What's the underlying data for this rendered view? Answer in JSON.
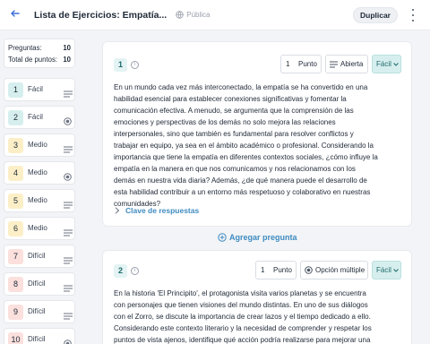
{
  "header": {
    "back_icon": "arrow-left-icon",
    "title": "Lista de Ejercicios: Empatía...",
    "visibility": "Pública",
    "duplicate_label": "Duplicar",
    "menu_icon": "more-vertical-icon"
  },
  "summary": {
    "questions_label": "Preguntas:",
    "questions_value": "10",
    "points_label": "Total de puntos:",
    "points_value": "10"
  },
  "questions": [
    {
      "num": "1",
      "difficulty": "Fácil",
      "type_icon": "lines-icon",
      "color": "#d6efee"
    },
    {
      "num": "2",
      "difficulty": "Fácil",
      "type_icon": "radio-icon",
      "color": "#d6efee"
    },
    {
      "num": "3",
      "difficulty": "Medio",
      "type_icon": "lines-icon",
      "color": "#fcefc7"
    },
    {
      "num": "4",
      "difficulty": "Medio",
      "type_icon": "radio-icon",
      "color": "#fcefc7"
    },
    {
      "num": "5",
      "difficulty": "Medio",
      "type_icon": "lines-icon",
      "color": "#fcefc7"
    },
    {
      "num": "6",
      "difficulty": "Medio",
      "type_icon": "lines-icon",
      "color": "#fcefc7"
    },
    {
      "num": "7",
      "difficulty": "Difícil",
      "type_icon": "lines-icon",
      "color": "#fbe0dd"
    },
    {
      "num": "8",
      "difficulty": "Difícil",
      "type_icon": "lines-icon",
      "color": "#fbe0dd"
    },
    {
      "num": "9",
      "difficulty": "Difícil",
      "type_icon": "lines-icon",
      "color": "#fbe0dd"
    },
    {
      "num": "10",
      "difficulty": "Difícil",
      "type_icon": "radio-icon",
      "color": "#fbe0dd"
    }
  ],
  "card1": {
    "number": "1",
    "points_value": "1",
    "points_label": "Punto",
    "type_label": "Abierta",
    "difficulty": "Fácil",
    "text": "En un mundo cada vez más interconectado, la empatía se ha convertido en una habilidad esencial para establecer conexiones significativas y fomentar la comunicación efectiva. A menudo, se argumenta que la comprensión de las emociones y perspectivas de los demás no solo mejora las relaciones interpersonales, sino que también es fundamental para resolver conflictos y trabajar en equipo, ya sea en el ámbito académico o profesional. Considerando la importancia que tiene la empatía en diferentes contextos sociales, ¿cómo influye la empatía en la manera en que nos comunicamos y nos relacionamos con los demás en nuestra vida diaria? Además, ¿de qué manera puede el desarrollo de esta habilidad contribuir a un entorno más respetuoso y colaborativo en nuestras comunidades?",
    "answer_key_label": "Clave de respuestas"
  },
  "add_question_label": "Agregar pregunta",
  "card2": {
    "number": "2",
    "points_value": "1",
    "points_label": "Punto",
    "type_label": "Opción múltiple",
    "difficulty": "Fácil",
    "text": "En la historia 'El Principito', el protagonista visita varios planetas y se encuentra con personajes que tienen visiones del mundo distintas. En uno de sus diálogos con el Zorro, se discute la importancia de crear lazos y el tiempo dedicado a ello. Considerando este contexto literario y la necesidad de comprender y respetar los puntos de vista ajenos, identifique qué acción podría realizarse para mejorar una"
  },
  "colors": {
    "accent": "#3b6fd8",
    "link": "#3f8bbf",
    "easy": "#d6efee",
    "medium": "#fcefc7",
    "hard": "#fbe0dd"
  }
}
